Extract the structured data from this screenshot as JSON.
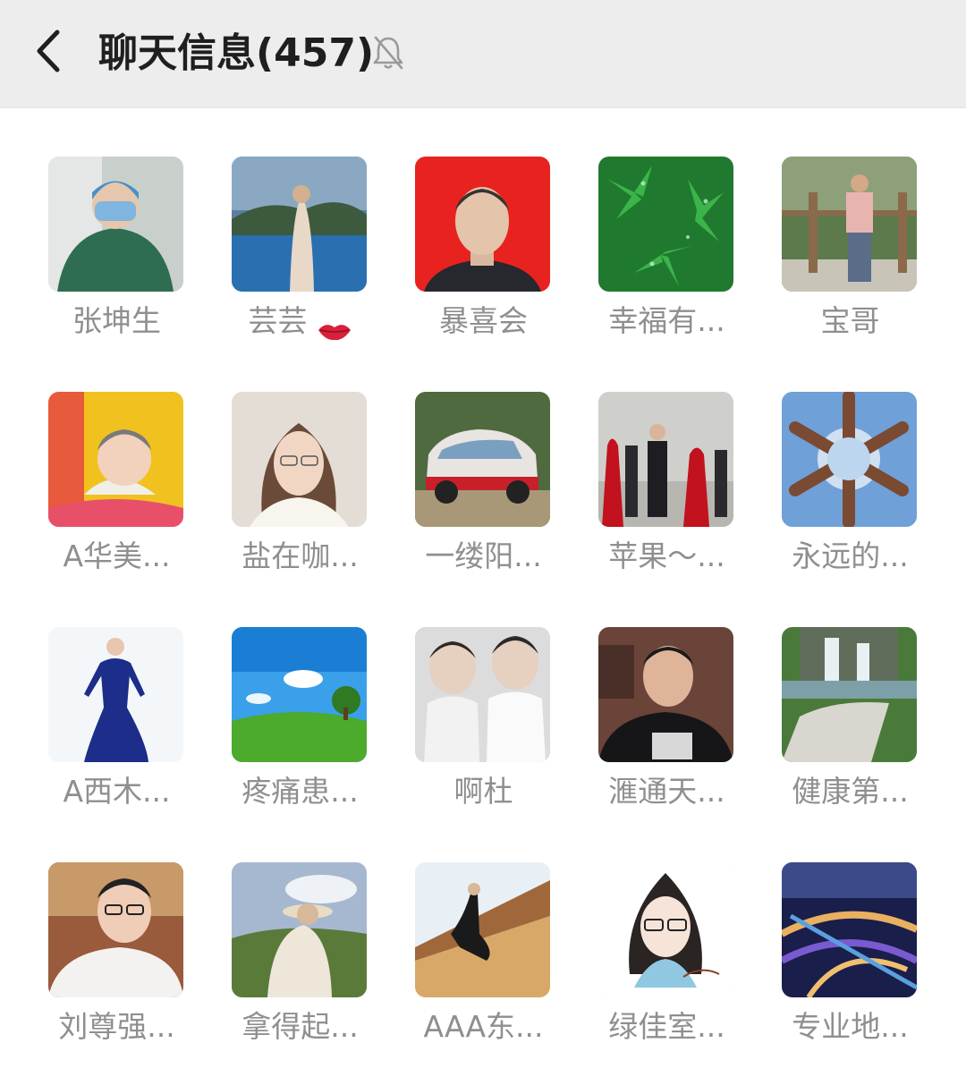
{
  "header": {
    "title": "聊天信息(457)",
    "back_icon": "chevron-left-icon",
    "mute_icon": "bell-off-icon"
  },
  "members": [
    {
      "name": "张坤生",
      "avatar": "doctor-photo"
    },
    {
      "name": "芸芸",
      "avatar": "lake-photo",
      "emoji": "lips-icon"
    },
    {
      "name": "暴喜会",
      "avatar": "portrait-red-photo"
    },
    {
      "name": "幸福有...",
      "avatar": "green-leaves-photo"
    },
    {
      "name": "宝哥",
      "avatar": "man-forest-photo"
    },
    {
      "name": "A华美...",
      "avatar": "baby-photo"
    },
    {
      "name": "盐在咖...",
      "avatar": "woman-glasses-photo"
    },
    {
      "name": "一缕阳...",
      "avatar": "rally-car-photo"
    },
    {
      "name": "苹果～...",
      "avatar": "ceremony-photo"
    },
    {
      "name": "永远的...",
      "avatar": "hands-sky-photo"
    },
    {
      "name": "A西木...",
      "avatar": "blue-dress-photo"
    },
    {
      "name": "疼痛患...",
      "avatar": "meadow-tree-photo"
    },
    {
      "name": "啊杜",
      "avatar": "twins-photo"
    },
    {
      "name": "滙通天...",
      "avatar": "man-shirt-photo"
    },
    {
      "name": "健康第...",
      "avatar": "waterfall-photo"
    },
    {
      "name": "刘尊强...",
      "avatar": "man-cafe-photo"
    },
    {
      "name": "拿得起...",
      "avatar": "woman-hat-photo"
    },
    {
      "name": "AAA东...",
      "avatar": "bridge-photo"
    },
    {
      "name": "绿佳室...",
      "avatar": "cartoon-girl-photo"
    },
    {
      "name": "专业地...",
      "avatar": "highway-night-photo"
    }
  ]
}
